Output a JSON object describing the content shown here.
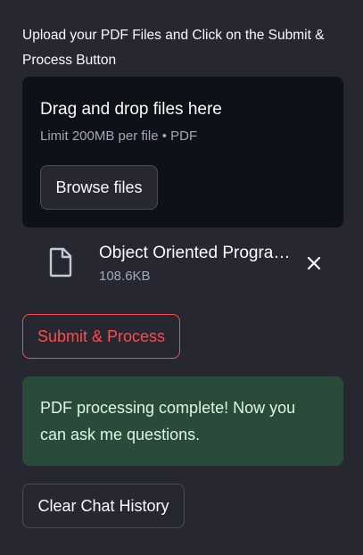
{
  "uploader": {
    "label": "Upload your PDF Files and Click on the Submit & Process Button",
    "dropzone_title": "Drag and drop files here",
    "dropzone_limit": "Limit 200MB per file • PDF",
    "browse_label": "Browse files"
  },
  "uploaded_file": {
    "name": "Object Oriented Programming.pdf",
    "size": "108.6KB",
    "icon": "file-icon",
    "remove_icon": "close-icon"
  },
  "actions": {
    "submit_label": "Submit & Process",
    "clear_label": "Clear Chat History"
  },
  "status": {
    "message": "PDF processing complete! Now you can ask me questions."
  },
  "colors": {
    "background": "#262730",
    "dropzone_bg": "#0e1117",
    "accent": "#ff4b4b",
    "success_bg": "#2a4b3a",
    "muted_text": "#a3a8b8"
  }
}
